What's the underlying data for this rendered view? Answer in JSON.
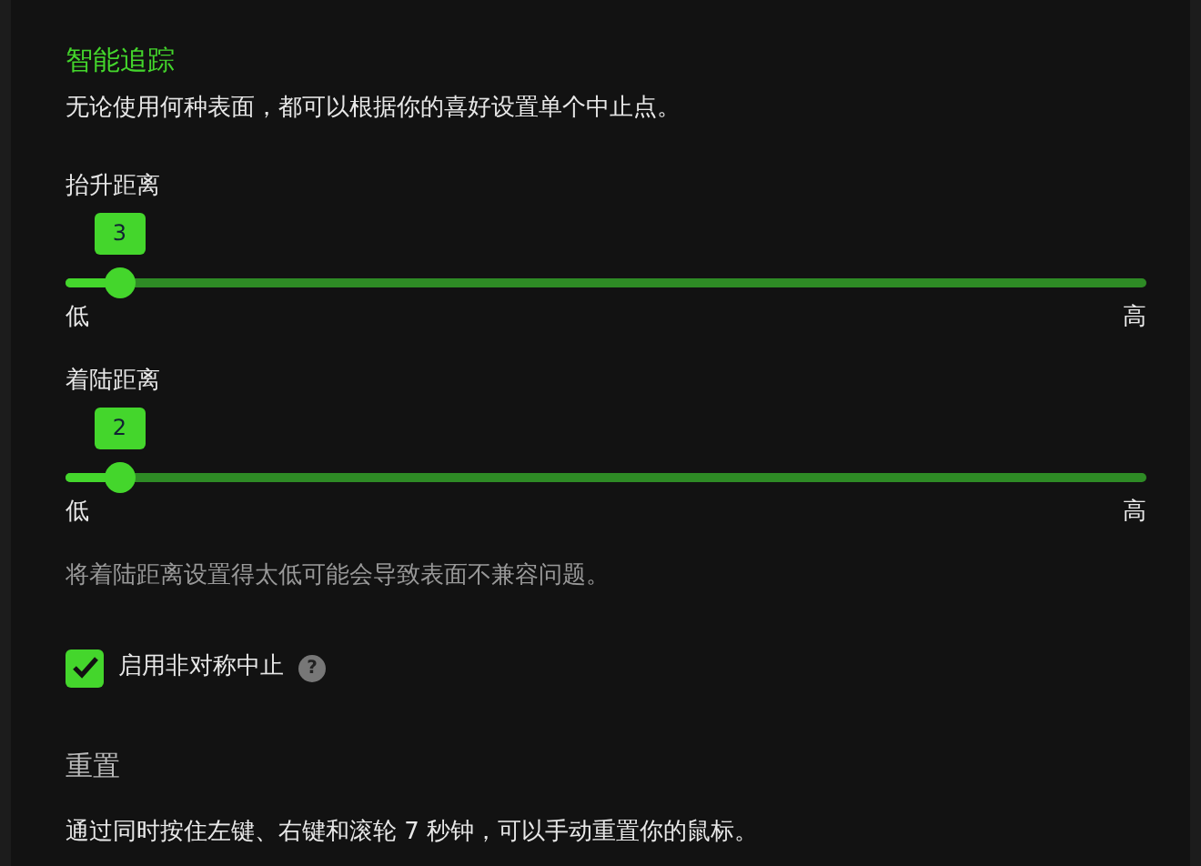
{
  "section": {
    "title": "智能追踪",
    "description": "无论使用何种表面，都可以根据你的喜好设置单个中止点。"
  },
  "sliders": [
    {
      "label": "抬升距离",
      "value": "3",
      "level": 0.05,
      "min_label": "低",
      "max_label": "高"
    },
    {
      "label": "着陆距离",
      "value": "2",
      "level": 0.05,
      "min_label": "低",
      "max_label": "高"
    }
  ],
  "note": "将着陆距离设置得太低可能会导致表面不兼容问题。",
  "checkbox": {
    "label": "启用非对称中止",
    "checked": true,
    "help": "?"
  },
  "reset": {
    "title": "重置",
    "description": "通过同时按住左键、右键和滚轮 7 秒钟，可以手动重置你的鼠标。"
  }
}
